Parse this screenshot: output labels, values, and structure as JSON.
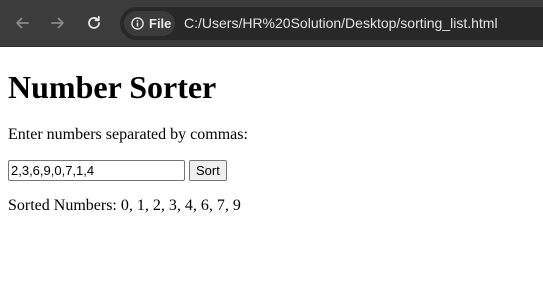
{
  "browser": {
    "site_chip_label": "File",
    "url": "C:/Users/HR%20Solution/Desktop/sorting_list.html",
    "toolbar_color": "#3c3c3c",
    "omnibox_color": "#282828"
  },
  "page": {
    "title": "Number Sorter",
    "prompt": "Enter numbers separated by commas:",
    "input_value": "2,3,6,9,0,7,1,4",
    "sort_button": "Sort",
    "result_label": "Sorted Numbers:",
    "result_values": "0, 1, 2, 3, 4, 6, 7, 9"
  },
  "icons": [
    "back-arrow-icon",
    "forward-arrow-icon",
    "reload-icon",
    "info-icon"
  ]
}
